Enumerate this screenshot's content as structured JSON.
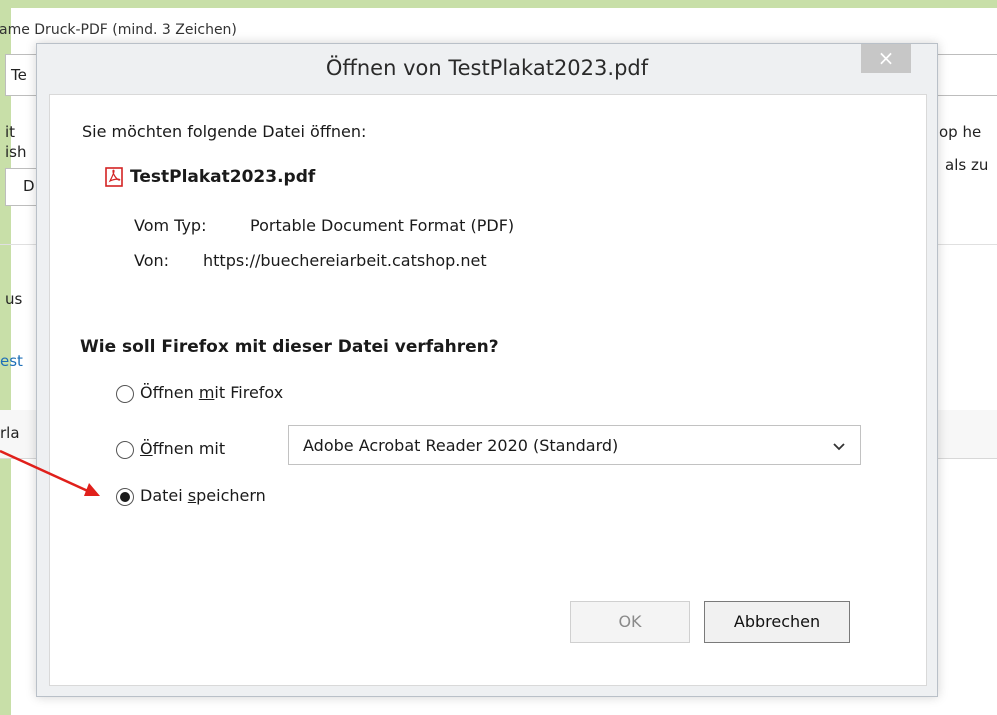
{
  "background": {
    "label_text": "ame Druck-PDF (mind. 3 Zeichen)",
    "input_value": "Te",
    "side_text_right_1": "op he",
    "side_text_right_2": "als zu",
    "left_frag_1": "it",
    "left_frag_2": "ish",
    "dropdown_value": "D",
    "left_frag_3": "us",
    "left_frag_4": "est",
    "left_frag_5": "rla"
  },
  "dialog": {
    "title": "Öffnen von TestPlakat2023.pdf",
    "close_label": "×",
    "prompt": "Sie möchten folgende Datei öffnen:",
    "file_icon": "pdf-file-icon",
    "filename": "TestPlakat2023.pdf",
    "type_label": "Vom Typ:",
    "type_value": "Portable Document Format (PDF)",
    "from_label": "Von:",
    "from_value": "https://buechereiarbeit.catshop.net",
    "question": "Wie soll Firefox mit dieser Datei verfahren?",
    "options": [
      {
        "pre": "Öffnen ",
        "accel": "m",
        "post": "it Firefox",
        "selected": false
      },
      {
        "pre": "",
        "accel": "Ö",
        "post": "ffnen mit",
        "selected": false
      },
      {
        "pre": "Datei ",
        "accel": "s",
        "post": "peichern",
        "selected": true
      }
    ],
    "app_select_value": "Adobe Acrobat Reader 2020 (Standard)",
    "ok_label": "OK",
    "cancel_label": "Abbrechen"
  },
  "colors": {
    "accent_green": "#c8dfa8",
    "annotation_arrow": "#e0201b",
    "pdf_red": "#d32323"
  }
}
